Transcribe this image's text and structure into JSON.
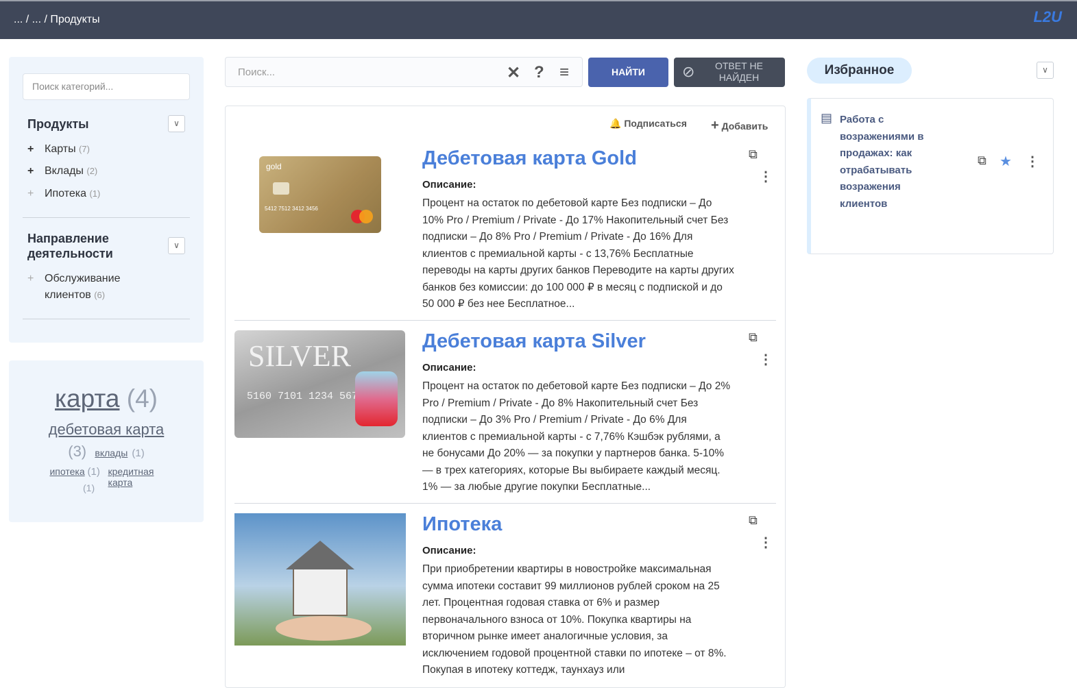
{
  "header": {
    "breadcrumb": "... / ... / Продукты",
    "logo": "L2U"
  },
  "sidebar": {
    "search_placeholder": "Поиск категорий...",
    "sections": [
      {
        "title": "Продукты",
        "items": [
          {
            "label": "Карты",
            "count": "(7)"
          },
          {
            "label": "Вклады",
            "count": "(2)"
          },
          {
            "label": "Ипотека",
            "count": "(1)"
          }
        ]
      },
      {
        "title": "Направление деятельности",
        "items": [
          {
            "label": "Обслуживание клиентов",
            "count": "(6)"
          }
        ]
      }
    ]
  },
  "tags": [
    {
      "label": "карта",
      "count": "(4)"
    },
    {
      "label": "дебетовая карта",
      "count": "(3)"
    },
    {
      "label": "вклады",
      "count": "(1)"
    },
    {
      "label": "ипотека",
      "count": "(1)"
    },
    {
      "label": "кредитная карта",
      "count": "(1)"
    }
  ],
  "search": {
    "placeholder": "Поиск...",
    "find_label": "НАЙТИ",
    "not_found_label": "ОТВЕТ НЕ НАЙДЕН"
  },
  "results_toolbar": {
    "subscribe": "Подписаться",
    "add": "Добавить"
  },
  "results": [
    {
      "title": "Дебетовая карта Gold",
      "desc_label": "Описание:",
      "image": "gold-card",
      "card_text": "gold",
      "card_number": "5412 7512 3412 3456",
      "description": "Процент на остаток по дебетовой карте Без подписки – До 10% Pro / Premium / Private - До  17% Накопительный счет Без подписки – До 8% Pro / Premium / Private - До 16% Для клиентов с премиальной карты - с 13,76% Бесплатные переводы на карты других банков Переводите на карты других банков без комиссии: до 100 000 ₽ в месяц с подпиской и до 50 000 ₽ без нее Бесплатное..."
    },
    {
      "title": "Дебетовая карта Silver",
      "desc_label": "Описание:",
      "image": "silver-card",
      "card_text": "SILVER",
      "card_number": "5160 7101 1234 5678",
      "description": " Процент на остаток по дебетовой карте Без подписки – До 2% Pro / Premium / Private - До 8% Накопительный счет Без подписки – До 3% Pro / Premium / Private - До 6% Для клиентов с премиальной карты - с 7,76% Кэшбэк рублями, а не бонусами До 20% — за покупки у партнеров банка. 5-10% — в трех категориях, которые Вы выбираете каждый месяц. 1% — за любые другие покупки Бесплатные..."
    },
    {
      "title": "Ипотека",
      "desc_label": "Описание:",
      "image": "house-in-hand",
      "description": "При приобретении квартиры в новостройке максимальная сумма ипотеки составит 99 миллионов рублей сроком на 25 лет. Процентная годовая ставка от 6% и размер первоначального взноса от 10%. Покупка квартиры на вторичном рынке имеет аналогичные условия, за исключением годовой процентной ставки по ипотеке – от 8%. Покупая в ипотеку коттедж, таунхауз или"
    }
  ],
  "favorites": {
    "title": "Избранное",
    "items": [
      {
        "title": "Работа с возражениями в продажах: как отрабатывать возражения клиентов"
      }
    ]
  },
  "colors": {
    "topbar": "#3f4759",
    "accent": "#4a7fd9",
    "find_button": "#4a63ad",
    "not_found_button": "#454c5a",
    "panel": "#eff5fc"
  }
}
